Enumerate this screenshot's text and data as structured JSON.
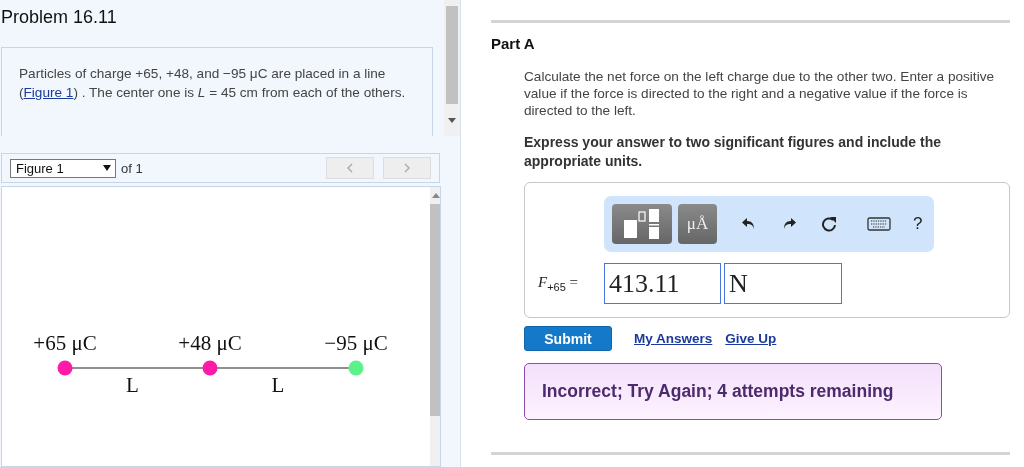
{
  "problem": {
    "title": "Problem 16.11",
    "text_before": "Particles of charge +65, +48, and −95 μC are placed in a line (",
    "link": "Figure 1",
    "text_after": ") . The center one is *L* = 45  cm from each of the others."
  },
  "figure_bar": {
    "select": "Figure 1",
    "count": "of 1"
  },
  "figure": {
    "charges": [
      {
        "label": "+65 μC",
        "color": "#ff1aa8"
      },
      {
        "label": "+48 μC",
        "color": "#ff1aa8"
      },
      {
        "label": "−95 μC",
        "color": "#5cf28a"
      }
    ],
    "spacings": [
      "L",
      "L"
    ]
  },
  "part": {
    "title": "Part A",
    "question": "Calculate the net force on the left charge due to the other two. Enter a positive value if the force is directed to the right and a negative value if the force is directed to the left.",
    "instruction": "Express your answer to two significant figures and include the appropriate units.",
    "toolbar": [
      {
        "kind": "templates"
      },
      {
        "kind": "units",
        "label": "μÅ"
      },
      {
        "kind": "undo"
      },
      {
        "kind": "redo"
      },
      {
        "kind": "reset"
      },
      {
        "kind": "keyboard"
      },
      {
        "kind": "help",
        "label": "?"
      }
    ],
    "answer_label": "*F*$_{+65}$ =",
    "value": "413.11",
    "unit": "N",
    "submit": "Submit",
    "links": [
      "My Answers",
      "Give Up"
    ],
    "feedback": "Incorrect; Try Again; 4 attempts remaining"
  }
}
